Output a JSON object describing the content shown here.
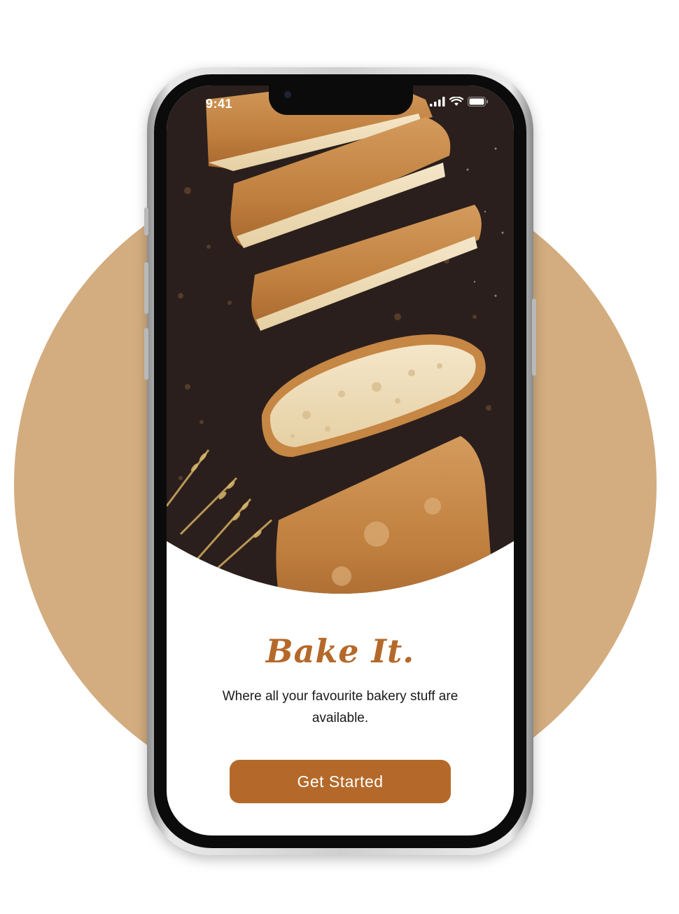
{
  "status_bar": {
    "time": "9:41",
    "icons": [
      "signal-icon",
      "wifi-icon",
      "battery-icon"
    ]
  },
  "hero": {
    "image": "sliced-baguette-photo"
  },
  "onboarding": {
    "title": "Bake It.",
    "subtitle": "Where all your favourite bakery stuff are available.",
    "cta_label": "Get Started"
  },
  "colors": {
    "accent": "#b4692a",
    "backdrop": "#d3ad7f",
    "screen_bg": "#ffffff",
    "hero_bg": "#2a1f1c"
  }
}
